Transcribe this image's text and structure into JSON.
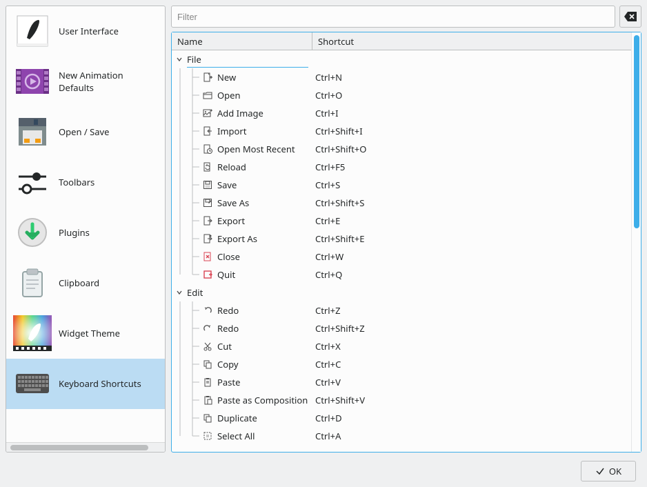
{
  "sidebar": {
    "items": [
      {
        "id": "user-interface",
        "label": "User Interface",
        "icon": "brush-doc",
        "selected": false
      },
      {
        "id": "animation-defaults",
        "label": "New Animation Defaults",
        "icon": "film-play",
        "selected": false
      },
      {
        "id": "open-save",
        "label": "Open / Save",
        "icon": "floppy",
        "selected": false
      },
      {
        "id": "toolbars",
        "label": "Toolbars",
        "icon": "sliders",
        "selected": false
      },
      {
        "id": "plugins",
        "label": "Plugins",
        "icon": "download-arrow",
        "selected": false
      },
      {
        "id": "clipboard",
        "label": "Clipboard",
        "icon": "clipboard",
        "selected": false
      },
      {
        "id": "widget-theme",
        "label": "Widget Theme",
        "icon": "color-wheel-brush",
        "selected": false
      },
      {
        "id": "keyboard-shortcuts",
        "label": "Keyboard Shortcuts",
        "icon": "keyboard",
        "selected": true
      }
    ]
  },
  "filter": {
    "placeholder": "Filter",
    "value": ""
  },
  "columns": {
    "name": "Name",
    "shortcut": "Shortcut"
  },
  "groups": [
    {
      "id": "file",
      "label": "File",
      "expanded": true,
      "actions": [
        {
          "icon": "file-new",
          "name": "New",
          "shortcut": "Ctrl+N"
        },
        {
          "icon": "folder-open",
          "name": "Open",
          "shortcut": "Ctrl+O"
        },
        {
          "icon": "image-add",
          "name": "Add Image",
          "shortcut": "Ctrl+I"
        },
        {
          "icon": "file-import",
          "name": "Import",
          "shortcut": "Ctrl+Shift+I"
        },
        {
          "icon": "recent",
          "name": "Open Most Recent",
          "shortcut": "Ctrl+Shift+O"
        },
        {
          "icon": "reload",
          "name": "Reload",
          "shortcut": "Ctrl+F5"
        },
        {
          "icon": "save",
          "name": "Save",
          "shortcut": "Ctrl+S"
        },
        {
          "icon": "save-as",
          "name": "Save As",
          "shortcut": "Ctrl+Shift+S"
        },
        {
          "icon": "export",
          "name": "Export",
          "shortcut": "Ctrl+E"
        },
        {
          "icon": "export-as",
          "name": "Export As",
          "shortcut": "Ctrl+Shift+E"
        },
        {
          "icon": "close",
          "name": "Close",
          "shortcut": "Ctrl+W",
          "color": "#da4453"
        },
        {
          "icon": "quit",
          "name": "Quit",
          "shortcut": "Ctrl+Q",
          "color": "#da4453"
        }
      ]
    },
    {
      "id": "edit",
      "label": "Edit",
      "expanded": true,
      "actions": [
        {
          "icon": "undo",
          "name": "Redo",
          "shortcut": "Ctrl+Z"
        },
        {
          "icon": "redo",
          "name": "Redo",
          "shortcut": "Ctrl+Shift+Z"
        },
        {
          "icon": "cut",
          "name": "Cut",
          "shortcut": "Ctrl+X"
        },
        {
          "icon": "copy",
          "name": "Copy",
          "shortcut": "Ctrl+C"
        },
        {
          "icon": "paste",
          "name": "Paste",
          "shortcut": "Ctrl+V"
        },
        {
          "icon": "paste-comp",
          "name": "Paste as Composition",
          "shortcut": "Ctrl+Shift+V"
        },
        {
          "icon": "duplicate",
          "name": "Duplicate",
          "shortcut": "Ctrl+D"
        },
        {
          "icon": "select-all",
          "name": "Select All",
          "shortcut": "Ctrl+A"
        }
      ]
    }
  ],
  "buttons": {
    "ok": "OK"
  }
}
